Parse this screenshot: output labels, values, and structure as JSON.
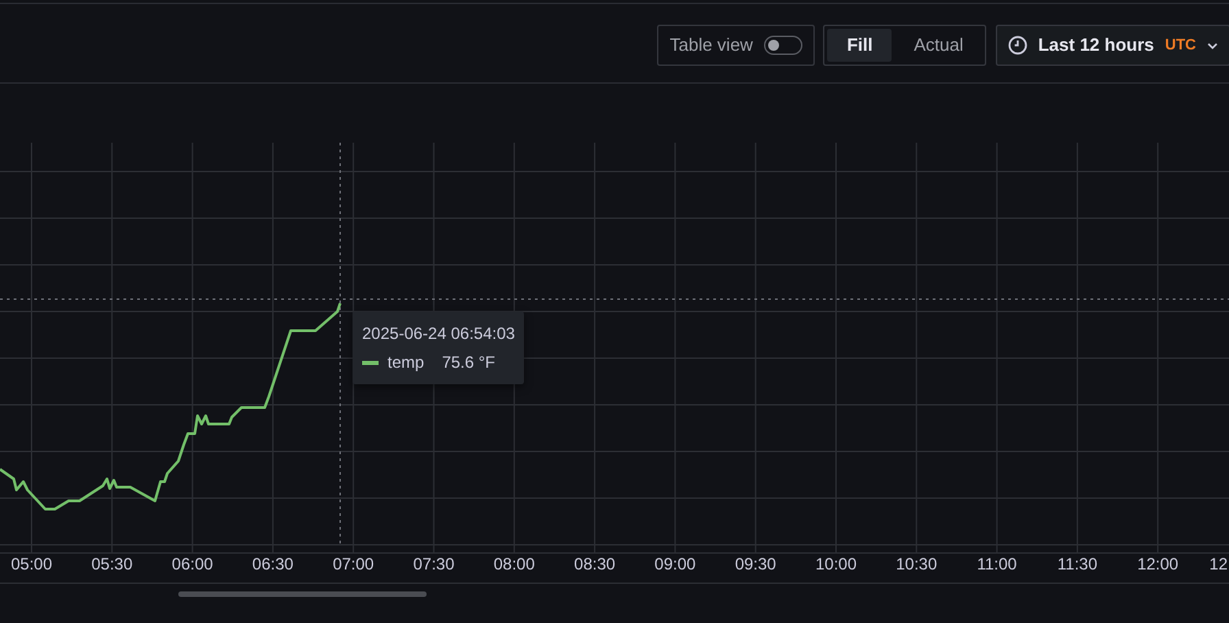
{
  "toolbar": {
    "table_view": {
      "label": "Table view",
      "on": false
    },
    "modes": [
      {
        "label": "Fill",
        "selected": true
      },
      {
        "label": "Actual",
        "selected": false
      }
    ],
    "time_range": {
      "label": "Last 12 hours",
      "timezone": "UTC"
    }
  },
  "chart": {
    "x_tick_labels": [
      "05:00",
      "05:30",
      "06:00",
      "06:30",
      "07:00",
      "07:30",
      "08:00",
      "08:30",
      "09:00",
      "09:30",
      "10:00",
      "10:30",
      "11:00",
      "11:30",
      "12:00",
      "12"
    ],
    "tooltip": {
      "time": "2025-06-24 06:54:03",
      "series": [
        {
          "name": "temp",
          "value": "75.6 °F"
        }
      ]
    }
  }
}
